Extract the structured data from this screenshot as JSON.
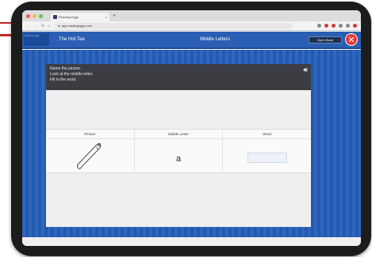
{
  "browser": {
    "tab_title": "Reading Eggs",
    "new_tab": "+",
    "tab_close": "×",
    "url": "app.readingeggs.com",
    "colors": {
      "close": "#ee5e57",
      "min": "#f4bd4f",
      "max": "#5ec454"
    }
  },
  "app": {
    "logo_text": "Reading Eggs",
    "title": "The Hot Tea",
    "lesson": "Middle Letters",
    "open_book_button": "Open Book",
    "close_icon": "close-icon"
  },
  "activity": {
    "instructions": [
      "Name the picture.",
      "Look at the middle letter.",
      "Fill in the word."
    ],
    "columns": [
      "Picture",
      "Middle Letter",
      "Word"
    ],
    "middle_letter": "a",
    "picture_icon": "baseball-bat",
    "word_value": ""
  }
}
